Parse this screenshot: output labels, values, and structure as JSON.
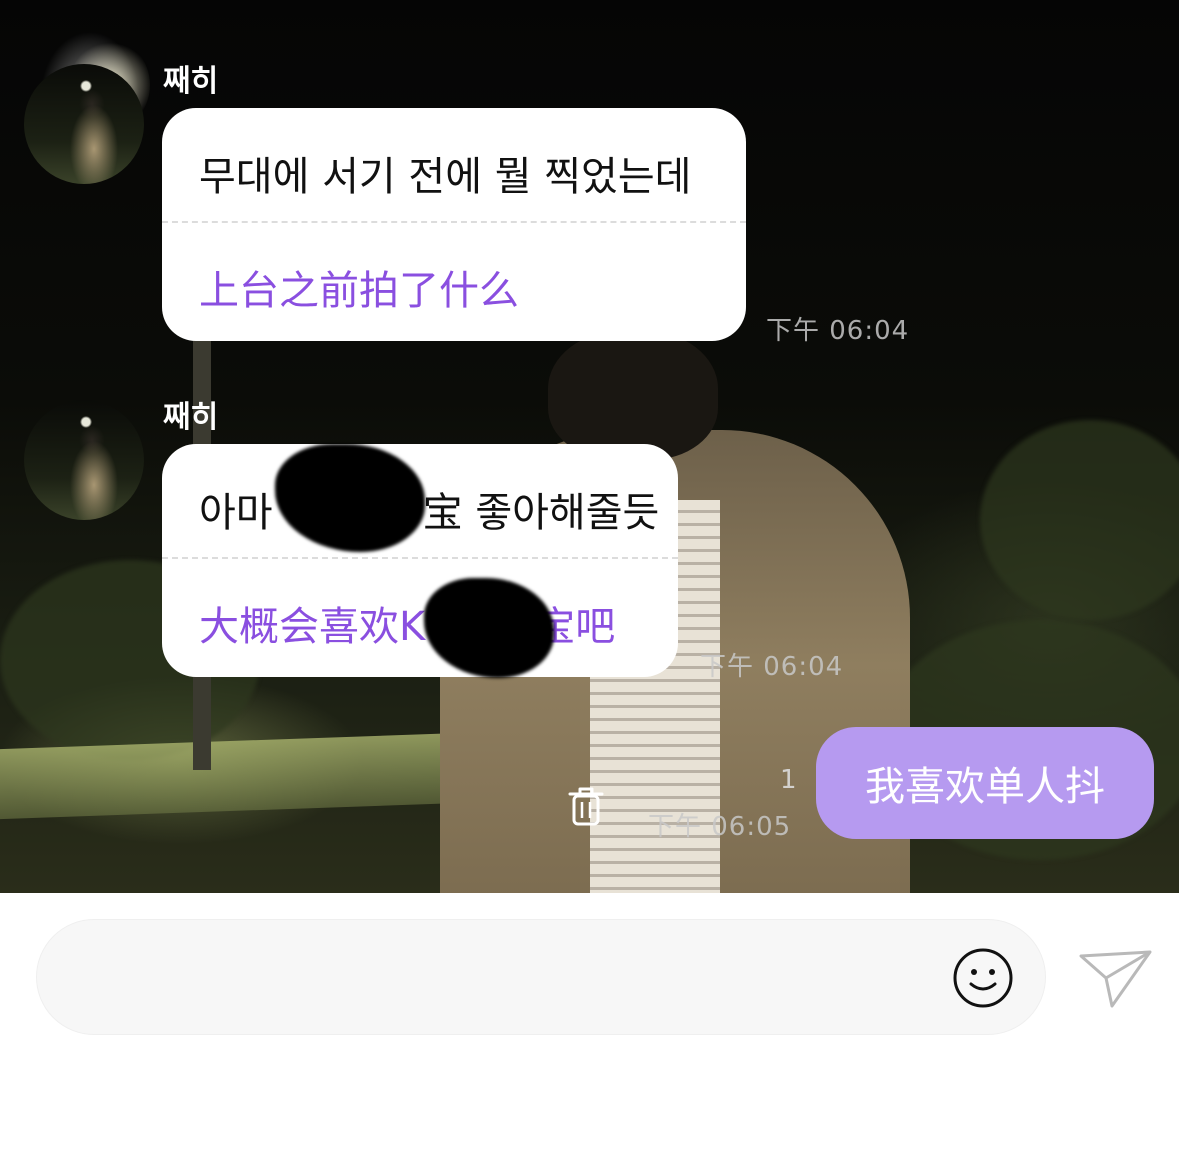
{
  "messages": [
    {
      "sender": "째히",
      "original": "무대에 서기 전에 뭘 찍었는데",
      "translation": "上台之前拍了什么",
      "time": "下午 06:04"
    },
    {
      "sender": "째히",
      "original": "아마 K 宝 좋아해줄듯",
      "original_visible_start": "아마",
      "original_visible_end": "宝 좋아해줄듯",
      "translation": "大概会喜欢K 宝吧",
      "translation_visible_start": "大概会喜欢K",
      "translation_visible_end": "宝吧",
      "time": "下午 06:04"
    }
  ],
  "outgoing": {
    "text": "我喜欢单人抖",
    "read_count": "1",
    "time": "下午 06:05"
  },
  "input": {
    "placeholder": "",
    "value": ""
  },
  "icons": {
    "trash": "trash-icon",
    "emoji": "smiley-icon",
    "send": "paper-plane-icon"
  },
  "colors": {
    "translation_text": "#8a4fe0",
    "outgoing_bubble": "#b69af0",
    "input_background": "#f7f7f7"
  }
}
